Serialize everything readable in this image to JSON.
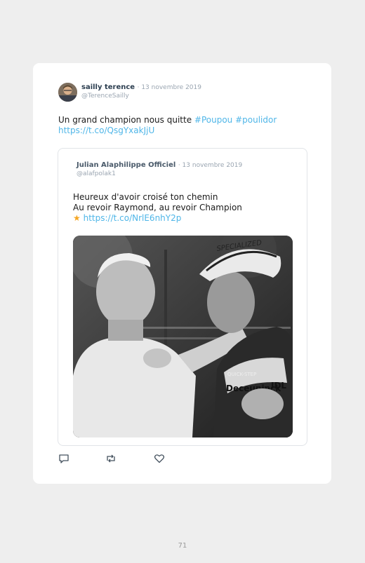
{
  "tweet": {
    "author_name": "sailly terence",
    "date": "13 novembre 2019",
    "handle": "@TerenceSailly",
    "text": "Un grand champion nous quitte ",
    "hashtags": [
      "#Poupou",
      "#poulidor"
    ],
    "link": "https://t.co/QsgYxakJjU"
  },
  "quoted": {
    "author_name": "Julian Alaphilippe Officiel",
    "date": "13 novembre 2019",
    "handle": "@alafpolak1",
    "line1": "Heureux d'avoir croisé ton chemin",
    "line2": "Au revoir Raymond, au revoir Champion",
    "star_icon": "star-icon",
    "link": "https://t.co/NrlE6nhY2p",
    "photo_texts": [
      "SPECIALIZED",
      "Deceuninck",
      "QUICK-STEP",
      "IDL"
    ]
  },
  "actions": {
    "reply_icon": "reply-icon",
    "retweet_icon": "retweet-icon",
    "like_icon": "heart-icon"
  },
  "page": {
    "number": "71"
  },
  "colors": {
    "link": "#4fb6e8",
    "star": "#f5a623",
    "background": "#eeeeee",
    "card": "#ffffff"
  }
}
